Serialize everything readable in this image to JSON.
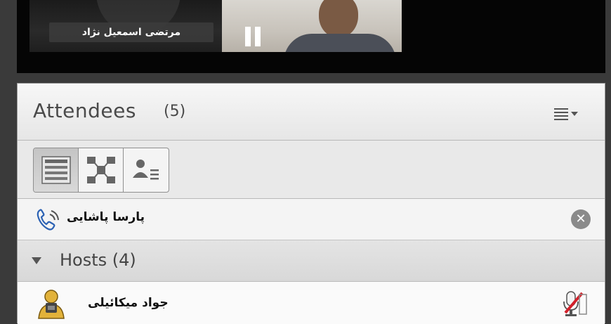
{
  "video": {
    "tile1": {
      "name": "مرتضی اسمعیل نژاد"
    },
    "tile2": {
      "control_icon": "pause-icon"
    }
  },
  "attendees": {
    "title": "Attendees",
    "count": "(5)",
    "menu_icon": "menu-lines-icon",
    "view_buttons": [
      "list-view-icon",
      "breakout-view-icon",
      "attendee-status-view-icon"
    ],
    "phone_participant": {
      "name": "پارسا پاشایی",
      "icon": "phone-icon",
      "close_icon": "close-circle-icon"
    },
    "hosts_section": {
      "label": "Hosts (4)"
    },
    "hosts": [
      {
        "name": "جواد میکائیلی",
        "avatar": "host-avatar-icon",
        "status_icon": "microphone-muted-icon"
      }
    ]
  },
  "colors": {
    "video_bg": "#050505",
    "pod_bg": "#ececec",
    "host_badge": "#e2b23a",
    "mic_red": "#d3202a"
  }
}
